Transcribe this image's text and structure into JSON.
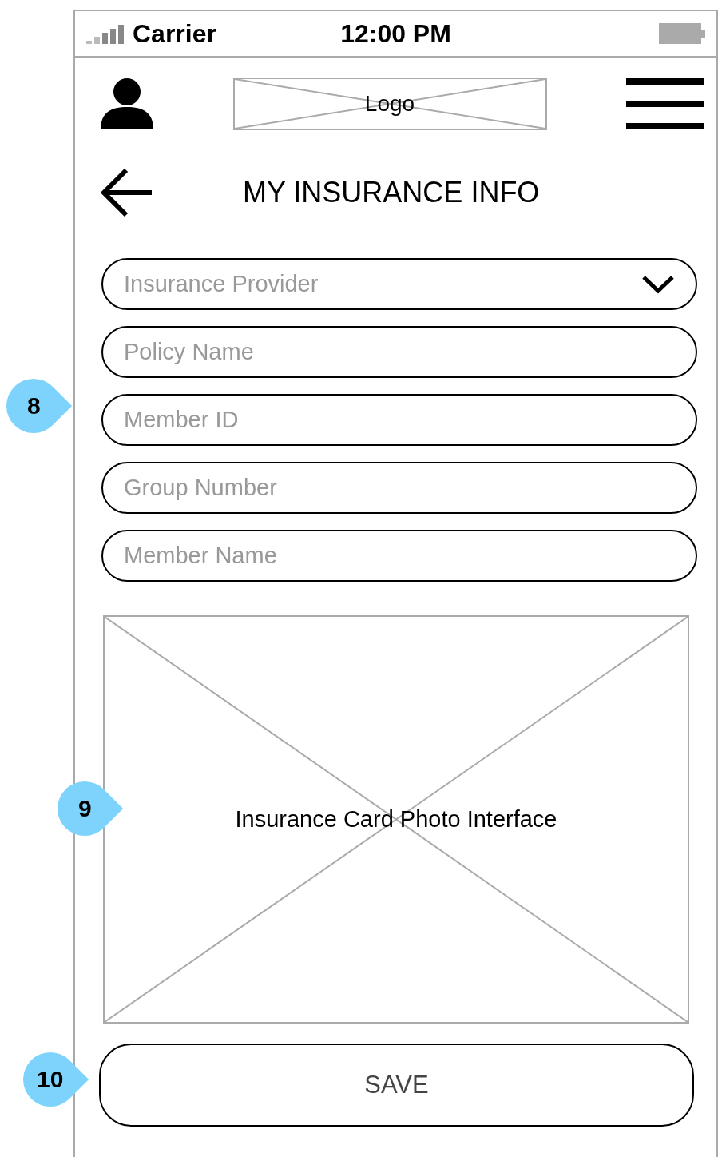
{
  "status_bar": {
    "carrier": "Carrier",
    "time": "12:00 PM"
  },
  "header": {
    "logo": "Logo"
  },
  "title": "MY INSURANCE INFO",
  "fields": [
    {
      "kind": "dropdown",
      "placeholder": "Insurance Provider"
    },
    {
      "kind": "text",
      "placeholder": "Policy Name"
    },
    {
      "kind": "text",
      "placeholder": "Member ID"
    },
    {
      "kind": "text",
      "placeholder": "Group Number"
    },
    {
      "kind": "text",
      "placeholder": "Member Name"
    }
  ],
  "photo_area": {
    "label": "Insurance Card Photo Interface"
  },
  "save_button": "SAVE",
  "callouts": [
    {
      "label": "8"
    },
    {
      "label": "9"
    },
    {
      "label": "10"
    }
  ]
}
